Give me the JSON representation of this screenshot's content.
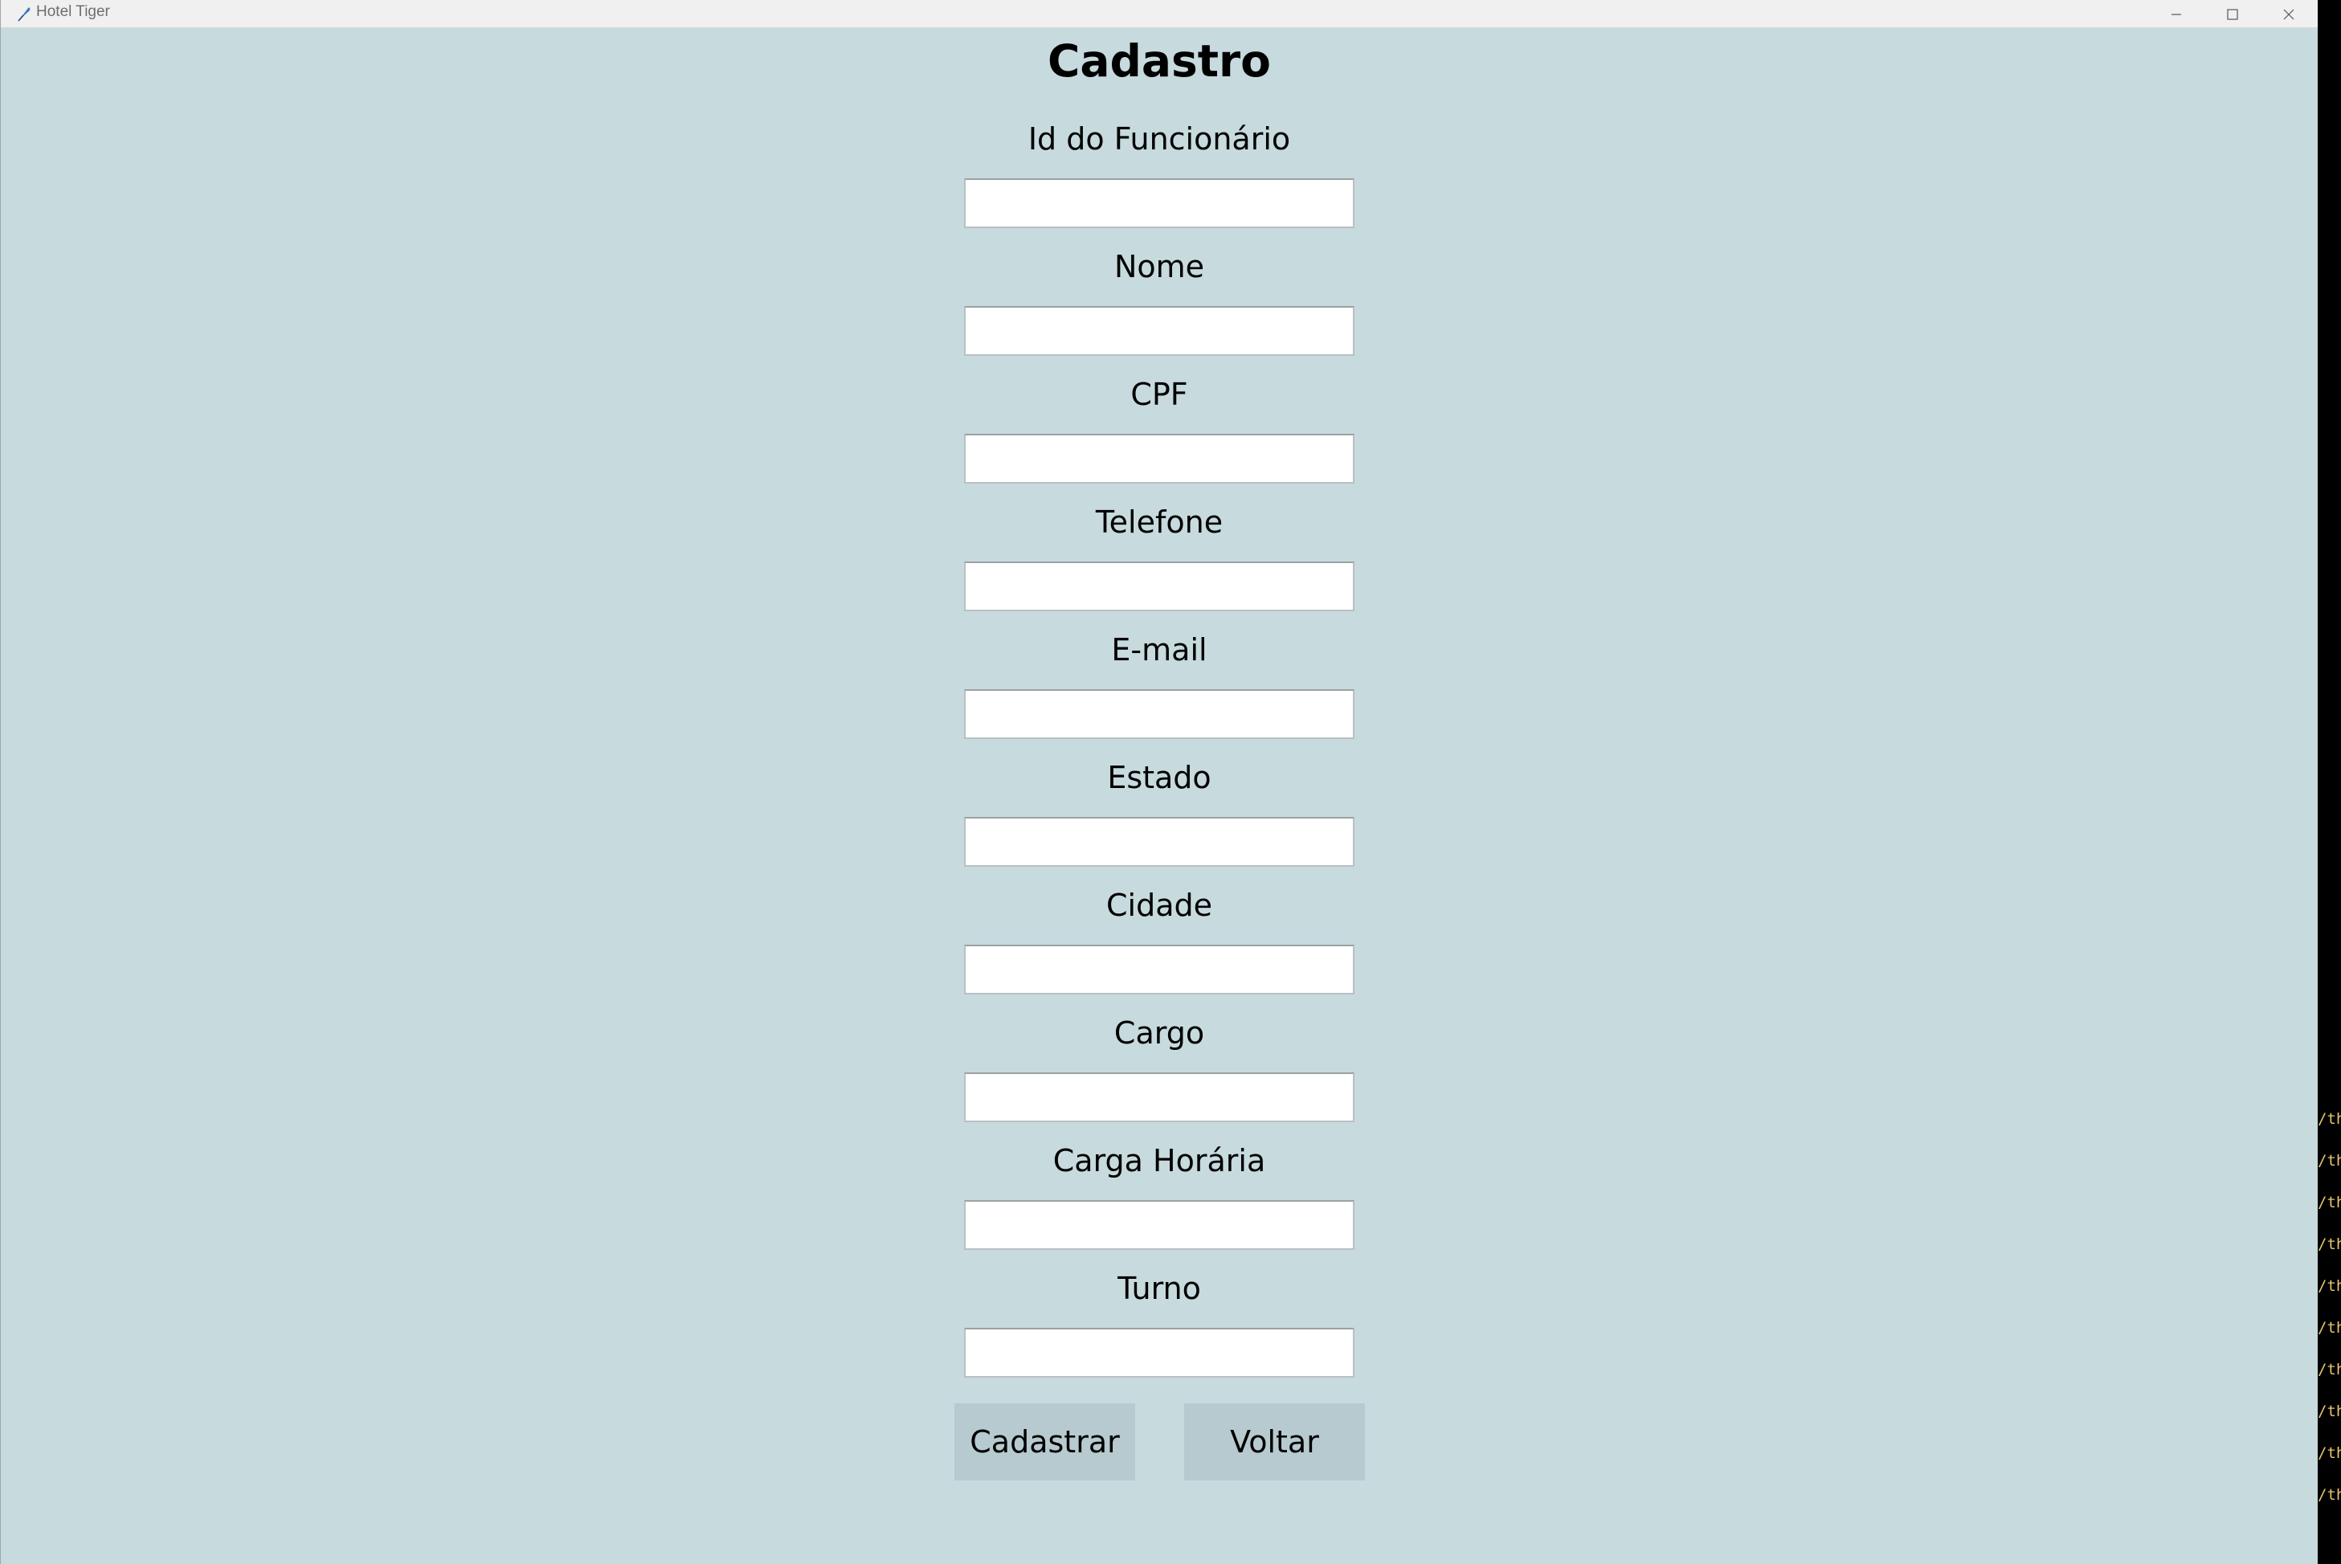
{
  "window": {
    "title": "Hotel Tiger",
    "icon": "feather-icon",
    "controls": [
      "minimize-icon",
      "maximize-icon",
      "close-icon"
    ]
  },
  "form": {
    "title": "Cadastro",
    "fields": [
      {
        "label": "Id do Funcionário",
        "value": ""
      },
      {
        "label": "Nome",
        "value": ""
      },
      {
        "label": "CPF",
        "value": ""
      },
      {
        "label": "Telefone",
        "value": ""
      },
      {
        "label": "E-mail",
        "value": ""
      },
      {
        "label": "Estado",
        "value": ""
      },
      {
        "label": "Cidade",
        "value": ""
      },
      {
        "label": "Cargo",
        "value": ""
      },
      {
        "label": "Carga Horária",
        "value": ""
      },
      {
        "label": "Turno",
        "value": ""
      }
    ],
    "buttons": {
      "submit_label": "Cadastrar",
      "back_label": "Voltar"
    }
  },
  "background_terminal": {
    "lines": [
      "/th",
      "/th",
      "/th",
      "/th",
      "/th",
      "/th",
      "/th",
      "/th",
      "/th",
      "/th"
    ]
  },
  "colors": {
    "window_background": "#c7dade",
    "button_background": "#b7cacf",
    "titlebar": "#f0f0f0"
  }
}
